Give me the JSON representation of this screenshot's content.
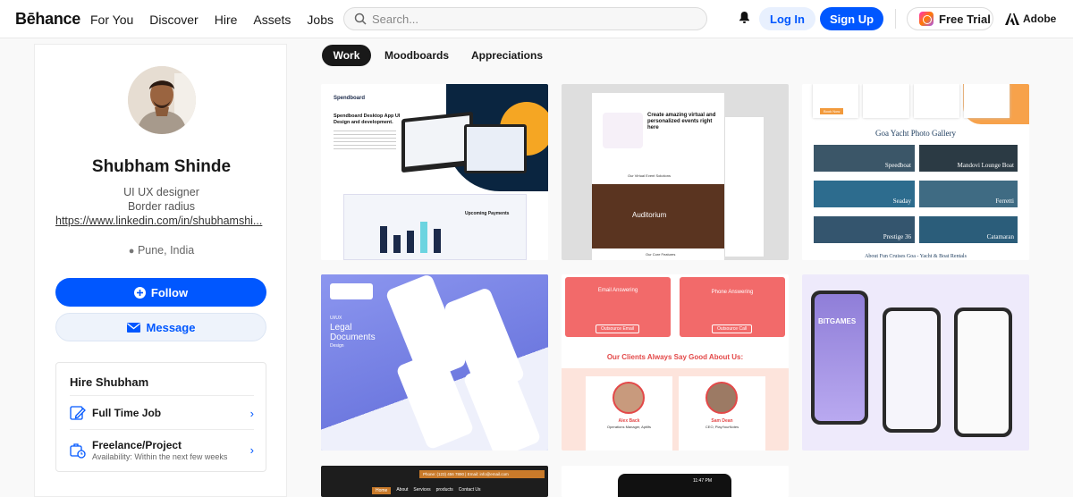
{
  "nav": {
    "logo": "Bēhance",
    "links": [
      "For You",
      "Discover",
      "Hire",
      "Assets",
      "Jobs"
    ],
    "search_placeholder": "Search...",
    "login": "Log In",
    "signup": "Sign Up",
    "free_trial": "Free Trial",
    "adobe": "Adobe"
  },
  "profile": {
    "name": "Shubham Shinde",
    "title": "UI UX designer",
    "subtitle": "Border radius",
    "link": "https://www.linkedin.com/in/shubhamshi...",
    "location": "Pune, India",
    "follow": "Follow",
    "message": "Message",
    "hire": {
      "title": "Hire Shubham",
      "full_time": "Full Time Job",
      "freelance": "Freelance/Project",
      "freelance_sub": "Availability: Within the next few weeks"
    }
  },
  "tabs": [
    "Work",
    "Moodboards",
    "Appreciations"
  ],
  "projects": {
    "spend": {
      "brand": "Spendboard",
      "headline": "Spendboard Desktop App UI Design and development.",
      "payments": "Upcoming Payments"
    },
    "events": {
      "headline": "Create amazing virtual and personalized events right here",
      "section": "Our Virtual Event Solutions",
      "venue": "Auditorium",
      "footer": "Our Core Features"
    },
    "yacht": {
      "gallery": "Goa Yacht Photo Gallery",
      "boats": [
        "Speedboat",
        "Mandovi Lounge Boat",
        "Seaday",
        "Ferretti",
        "Prestige 36",
        "Catamaran"
      ],
      "book": "Book Now",
      "footer": "About Fun Cruises Goa - Yacht & Boat Rentals"
    },
    "legal": {
      "tag": "UI/UX",
      "title_1": "Legal",
      "title_2": "Documents",
      "title_3": "Design"
    },
    "clients": {
      "email": "Email Answering",
      "phone": "Phone Answering",
      "email_btn": "Outsource Email",
      "phone_btn": "Outsource Call",
      "heading": "Our Clients Always Say Good About Us:",
      "client1_name": "Alex Back",
      "client1_role": "Operations Manager, Aptilfs",
      "client2_name": "Sam Dean",
      "client2_role": "CEO, PlayYourNotes"
    },
    "games": {
      "brand": "BITGAMES"
    },
    "restaurant": {
      "phone": "Phone: (123) 456 7890 | Email: info@email.com",
      "menu": [
        "Home",
        "About",
        "Services",
        "products",
        "Contact Us"
      ]
    },
    "mobile": {
      "time": "11:47 PM"
    }
  },
  "colors": {
    "accent": "#0057ff",
    "tab_active": "#191919"
  }
}
